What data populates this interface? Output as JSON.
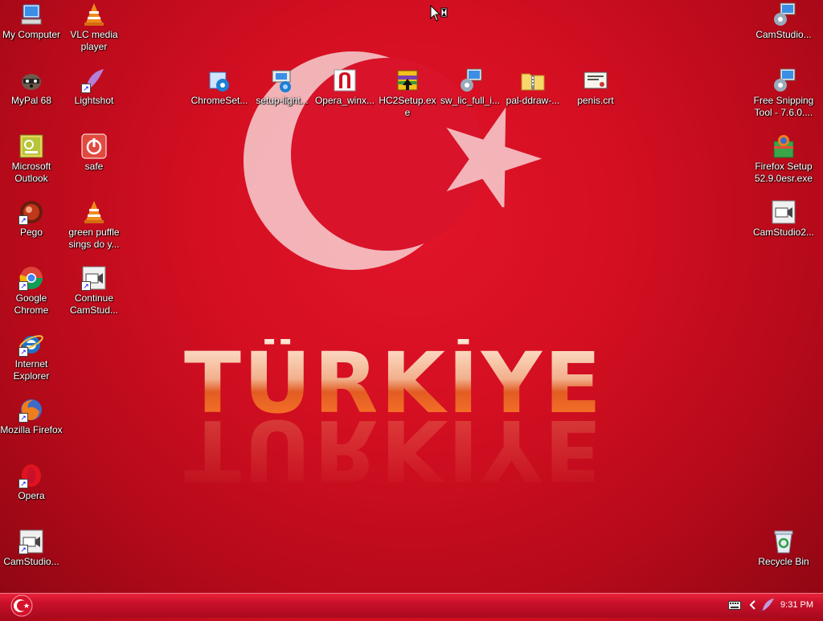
{
  "wallpaper": {
    "title": "TÜRKİYE"
  },
  "icons": {
    "my_computer": "My Computer",
    "vlc": "VLC media player",
    "mypal": "MyPal 68",
    "lightshot": "Lightshot",
    "outlook": "Microsoft Outlook",
    "safe": "safe",
    "pego": "Pego",
    "green_puffle": "green puffle sings do y...",
    "chrome": "Google Chrome",
    "continue_cam": "Continue CamStud...",
    "ie": "Internet Explorer",
    "firefox": "Mozilla Firefox",
    "opera": "Opera",
    "camstudio_bl": "CamStudio...",
    "chromeset": "ChromeSet...",
    "setup_light": "setup-light...",
    "opera_win": "Opera_winx...",
    "hc2setup": "HC2Setup.exe",
    "sw_lic": "sw_lic_full_i...",
    "pal_ddraw": "pal-ddraw-...",
    "penis_crt": "penis.crt",
    "camstudio_tr": "CamStudio...",
    "free_snipping": "Free Snipping Tool - 7.6.0....",
    "firefox_setup": "Firefox Setup 52.9.0esr.exe",
    "camstudio2": "CamStudio2...",
    "recycle": "Recycle Bin"
  },
  "taskbar": {
    "clock": "9:31 PM"
  },
  "colors": {
    "wallpaper_red": "#d50f22",
    "taskbar_red": "#c8102a",
    "label_text": "#ffffff"
  }
}
